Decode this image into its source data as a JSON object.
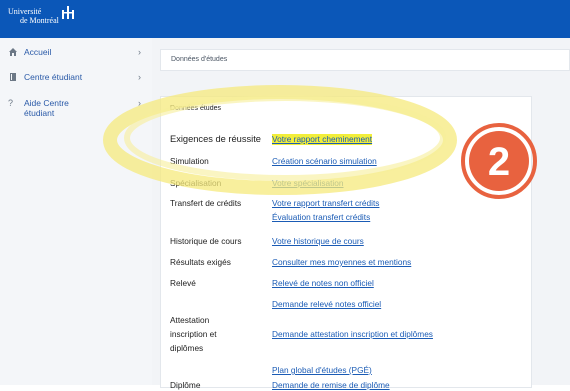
{
  "header": {
    "logo_line1": "Université",
    "logo_line2": "de Montréal"
  },
  "sidebar": {
    "items": [
      {
        "label": "Accueil",
        "icon": "home-icon"
      },
      {
        "label": "Centre étudiant",
        "icon": "book-icon"
      },
      {
        "label": "Aide Centre étudiant",
        "label_line1": "Aide Centre",
        "label_line2": "étudiant",
        "icon": "question-icon"
      }
    ]
  },
  "breadcrumb": "Données d'études",
  "card": {
    "title": "Données études",
    "rows": [
      {
        "label": "Exigences de réussite",
        "links": [
          "Votre rapport cheminement"
        ]
      },
      {
        "label": "Simulation",
        "links": [
          "Création scénario simulation"
        ]
      },
      {
        "label": "Spécialisation",
        "links": [
          "Votre spécialisation"
        ]
      },
      {
        "label": "Transfert de crédits",
        "links": [
          "Votre rapport transfert crédits",
          "Évaluation transfert crédits"
        ]
      },
      {
        "label": "Historique de cours",
        "links": [
          "Votre historique de cours"
        ]
      },
      {
        "label": "Résultats exigés",
        "links": [
          "Consulter mes moyennes et mentions"
        ]
      },
      {
        "label": "Relevé",
        "links": [
          "Relevé de notes non officiel",
          "Demande relevé notes officiel"
        ]
      },
      {
        "label": "Attestation inscription et diplômes",
        "label_lines": [
          "Attestation",
          "inscription et",
          "diplômes"
        ],
        "links": [
          "Demande attestation inscription et diplômes"
        ]
      },
      {
        "label": "Diplôme",
        "links": [
          "Plan global d'études (PGÉ)",
          "Demande de remise de diplôme"
        ]
      }
    ]
  },
  "annotation": {
    "badge_number": "2",
    "badge_color": "#e8623f",
    "brush_color": "#f5ea7c",
    "highlight_color": "#f2ee3a"
  },
  "colors": {
    "topbar": "#0b57b8",
    "link": "#1a5bb5"
  }
}
